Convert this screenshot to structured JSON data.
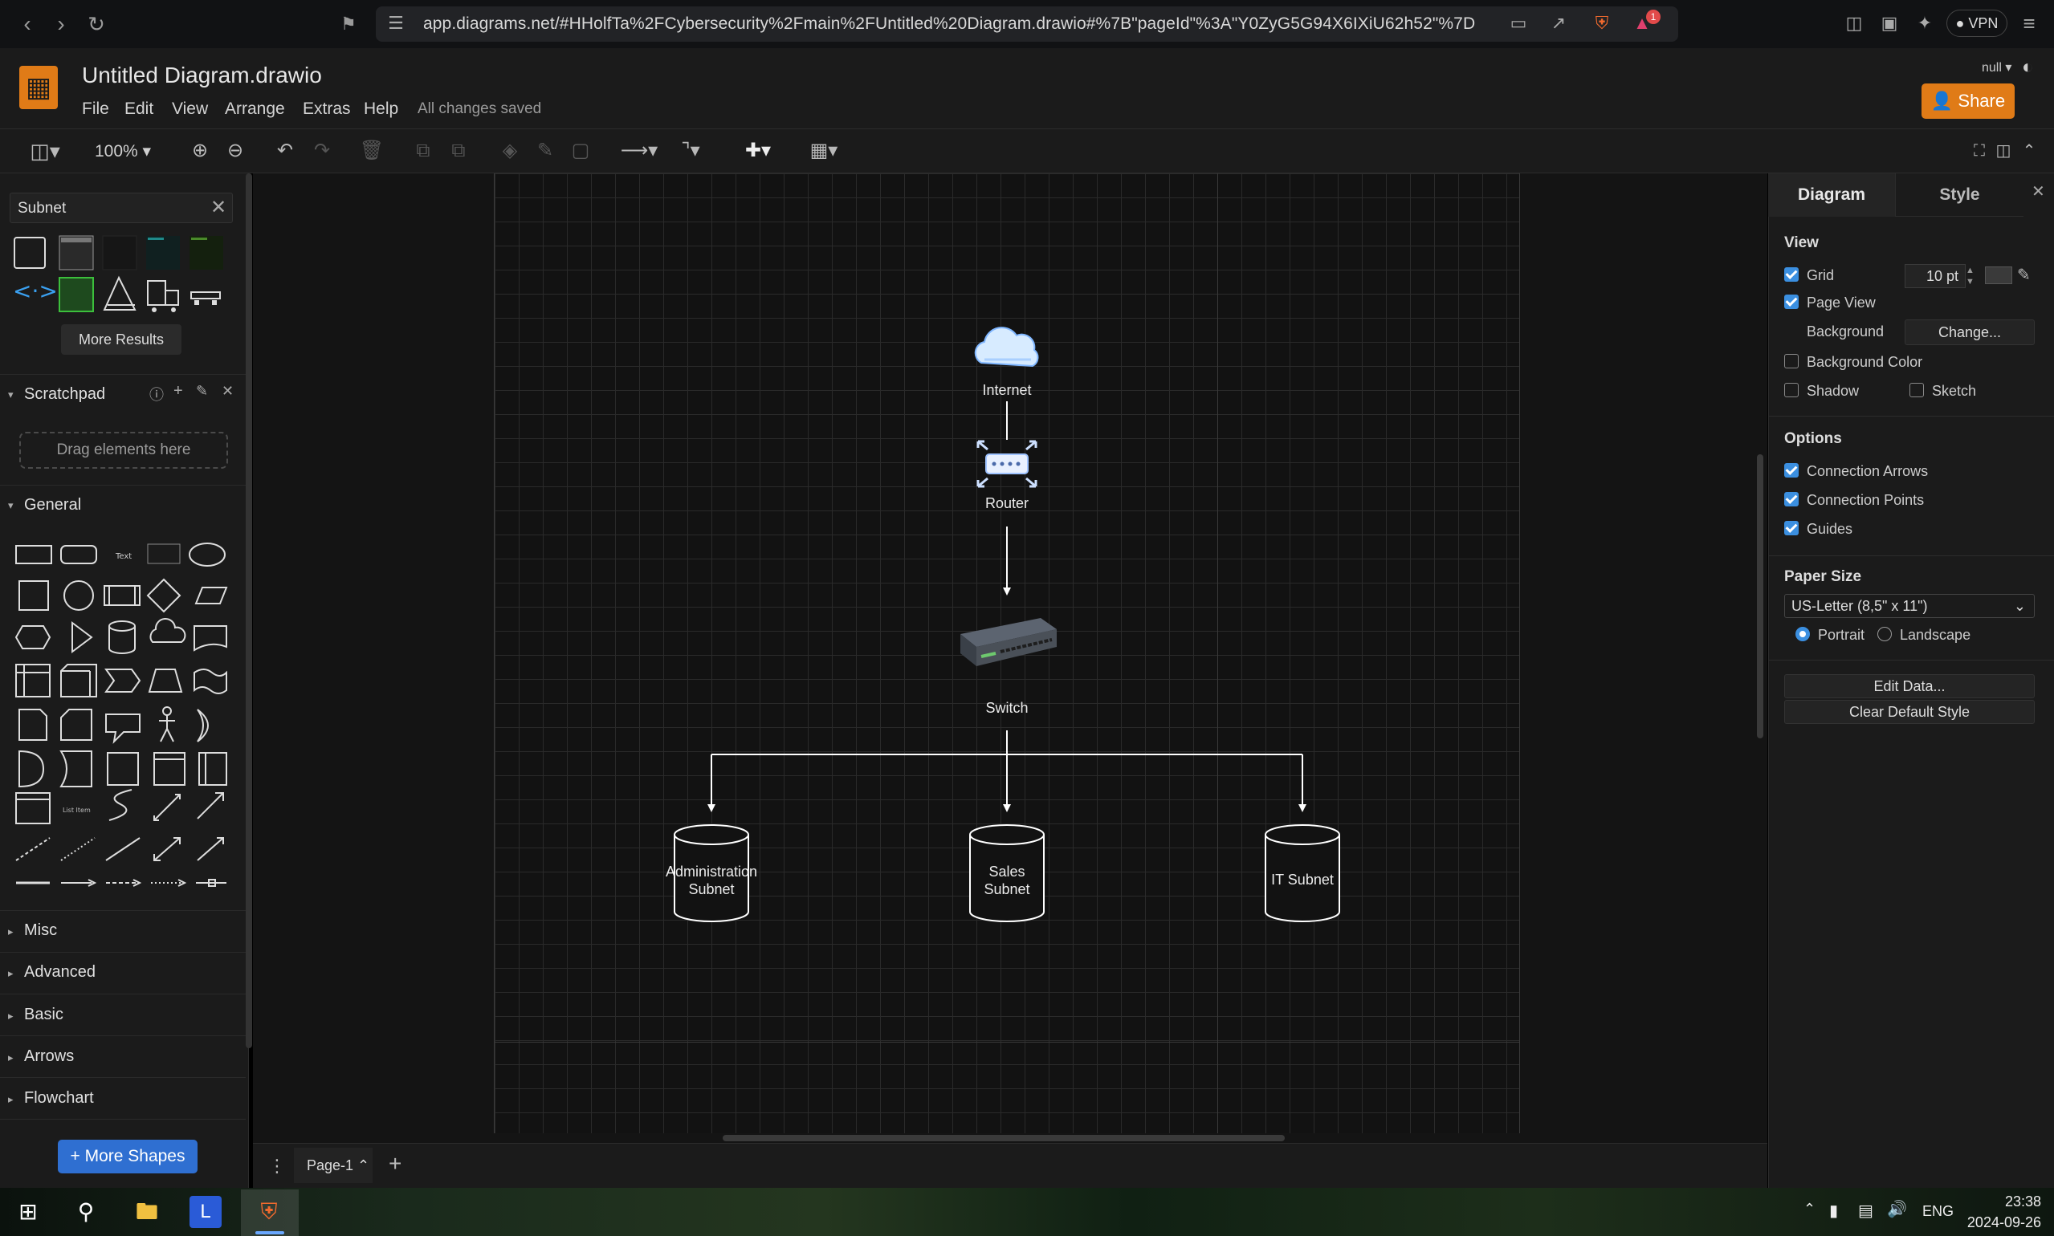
{
  "browser": {
    "url": "app.diagrams.net/#HHolfTa%2FCybersecurity%2Fmain%2FUntitled%20Diagram.drawio#%7B\"pageId\"%3A\"Y0ZyG5G94X6IXiU62h52\"%7D",
    "vpn_label": "VPN",
    "notif_count": "1"
  },
  "app": {
    "title": "Untitled Diagram.drawio",
    "menus": [
      "File",
      "Edit",
      "View",
      "Arrange",
      "Extras",
      "Help"
    ],
    "save_status": "All changes saved",
    "share_label": "Share",
    "user_label": "null",
    "accent": "#e07b17"
  },
  "toolbar": {
    "zoom": "100%"
  },
  "left": {
    "search_value": "Subnet",
    "more_results": "More Results",
    "scratchpad": "Scratchpad",
    "drop_hint": "Drag elements here",
    "general": "General",
    "sections": [
      "Misc",
      "Advanced",
      "Basic",
      "Arrows",
      "Flowchart"
    ],
    "more_shapes": "+ More Shapes"
  },
  "diagram": {
    "nodes": {
      "internet": "Internet",
      "router": "Router",
      "switch": "Switch",
      "admin": [
        "Administration",
        "Subnet"
      ],
      "sales": [
        "Sales",
        "Subnet"
      ],
      "it": "IT Subnet"
    }
  },
  "pages": {
    "current": "Page-1"
  },
  "right": {
    "tab_diagram": "Diagram",
    "tab_style": "Style",
    "view_heading": "View",
    "grid": "Grid",
    "grid_size": "10 pt",
    "page_view": "Page View",
    "background": "Background",
    "change": "Change...",
    "background_color": "Background Color",
    "shadow": "Shadow",
    "sketch": "Sketch",
    "options_heading": "Options",
    "connection_arrows": "Connection Arrows",
    "connection_points": "Connection Points",
    "guides": "Guides",
    "paper_size_heading": "Paper Size",
    "paper_size": "US-Letter (8,5\" x 11\")",
    "portrait": "Portrait",
    "landscape": "Landscape",
    "edit_data": "Edit Data...",
    "clear_default": "Clear Default Style"
  },
  "taskbar": {
    "lang": "ENG",
    "time": "23:38",
    "date": "2024-09-26"
  }
}
